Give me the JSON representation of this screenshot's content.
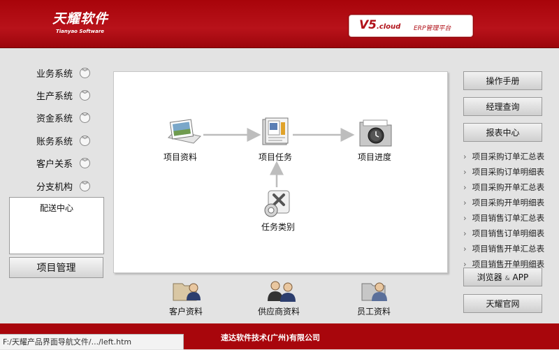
{
  "header": {
    "logo": "天耀软件",
    "logo_sub": "Tianyao Software",
    "version_main": "V5",
    "version_suffix": ".cloud",
    "platform_name": "ERP管理平台"
  },
  "left_nav": {
    "items": [
      "业务系统",
      "生产系统",
      "资金系统",
      "账务系统",
      "客户关系",
      "分支机构"
    ],
    "sub_item": "配送中心",
    "current_module": "项目管理"
  },
  "flow": {
    "project_data": "项目资料",
    "project_task": "项目任务",
    "project_progress": "项目进度",
    "task_category": "任务类别"
  },
  "right_panel": {
    "buttons": [
      "操作手册",
      "经理查询",
      "报表中心"
    ],
    "reports": [
      "项目采购订单汇总表",
      "项目采购订单明细表",
      "项目采购开单汇总表",
      "项目采购开单明细表",
      "项目销售订单汇总表",
      "项目销售订单明细表",
      "项目销售开单汇总表",
      "项目销售开单明细表"
    ],
    "browser_btn": "浏览器",
    "browser_amp": "&",
    "browser_app": "APP",
    "website_btn": "天耀官网"
  },
  "bottom_links": {
    "customer": "客户资料",
    "supplier": "供应商资料",
    "employee": "员工资料"
  },
  "footer": {
    "company": "速达软件技术(广州)有限公司"
  },
  "status_bar": {
    "path": "F:/天耀产品界面导航文件/.../left.htm"
  },
  "colors": {
    "header_red": "#b8121a",
    "footer_red": "#a8060c",
    "arrow_gray": "#bdbdbd"
  }
}
